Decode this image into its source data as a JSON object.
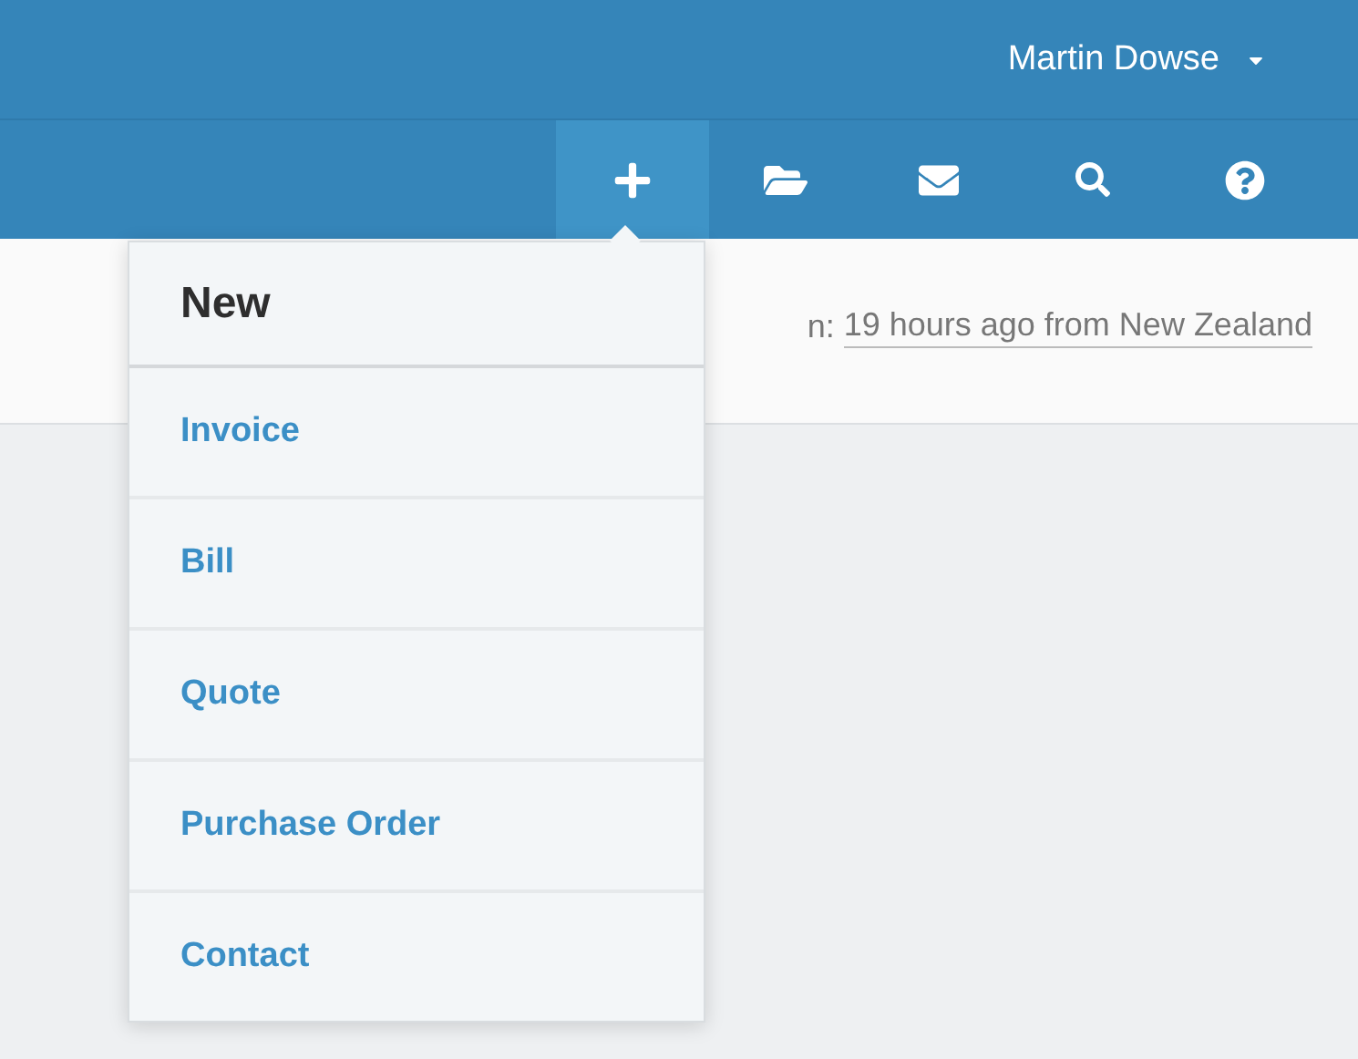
{
  "user_menu": {
    "name": "Martin Dowse"
  },
  "toolbar": [
    {
      "kind": "add",
      "selected": true
    },
    {
      "kind": "folder",
      "selected": false
    },
    {
      "kind": "mail",
      "selected": false
    },
    {
      "kind": "search",
      "selected": false
    },
    {
      "kind": "help",
      "selected": false
    }
  ],
  "login_info": {
    "prefix": "n:",
    "link": "19 hours ago from New Zealand"
  },
  "new_menu": {
    "title": "New",
    "items": [
      "Invoice",
      "Bill",
      "Quote",
      "Purchase Order",
      "Contact"
    ]
  }
}
